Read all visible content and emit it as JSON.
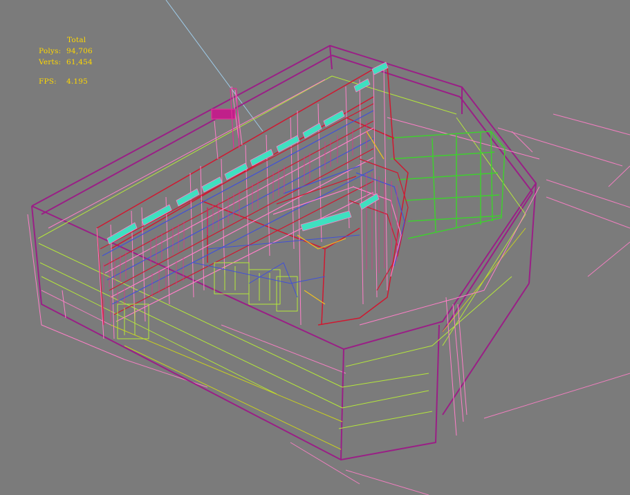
{
  "viewport": {
    "background": "#7b7b7b",
    "render_mode": "wireframe",
    "wire_colors": {
      "magenta": "#9a1f86",
      "pink": "#ff7fc8",
      "lime": "#b5e83a",
      "green": "#3fcf2f",
      "cyan": "#3fe0c0",
      "red": "#d01830",
      "blue": "#4050d8",
      "light_blue": "#9ecbe8",
      "olive": "#c8d020"
    }
  },
  "stats": {
    "header": "Total",
    "polys_label": "Polys:",
    "polys_value": "94,706",
    "verts_label": "Verts:",
    "verts_value": "61,454",
    "fps_label": "FPS:",
    "fps_value": "4.195",
    "text_color": "#ffd800"
  }
}
